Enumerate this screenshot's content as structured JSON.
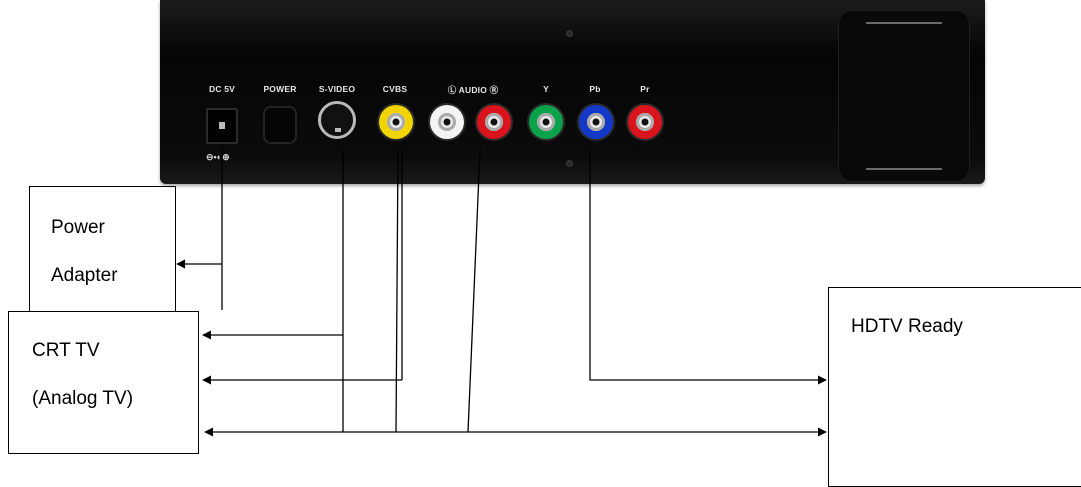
{
  "device": {
    "ports": [
      {
        "label": "DC 5V",
        "type": "dc-jack"
      },
      {
        "label": "POWER",
        "type": "button"
      },
      {
        "label": "S-VIDEO",
        "type": "s-video"
      },
      {
        "label": "CVBS",
        "type": "rca",
        "color": "#f2d400"
      },
      {
        "label": "",
        "type": "rca",
        "color": "#f4f4f4"
      },
      {
        "label": "",
        "type": "rca",
        "color": "#d9141c"
      },
      {
        "label": "Y",
        "type": "rca",
        "color": "#0aa24a"
      },
      {
        "label": "Pb",
        "type": "rca",
        "color": "#1438c8"
      },
      {
        "label": "Pr",
        "type": "rca",
        "color": "#d9141c"
      }
    ],
    "audio_label": "Ⓛ AUDIO Ⓡ",
    "polarity_symbol": "⊖•◐⊕"
  },
  "boxes": {
    "power_adapter": {
      "line1": "Power",
      "line2": "Adapter"
    },
    "crt_tv": {
      "line1": "CRT TV",
      "line2": "(Analog TV)"
    },
    "hdtv": {
      "line1": "HDTV Ready"
    }
  },
  "colors": {
    "line": "#000000",
    "panel": "#0a0a0a"
  }
}
